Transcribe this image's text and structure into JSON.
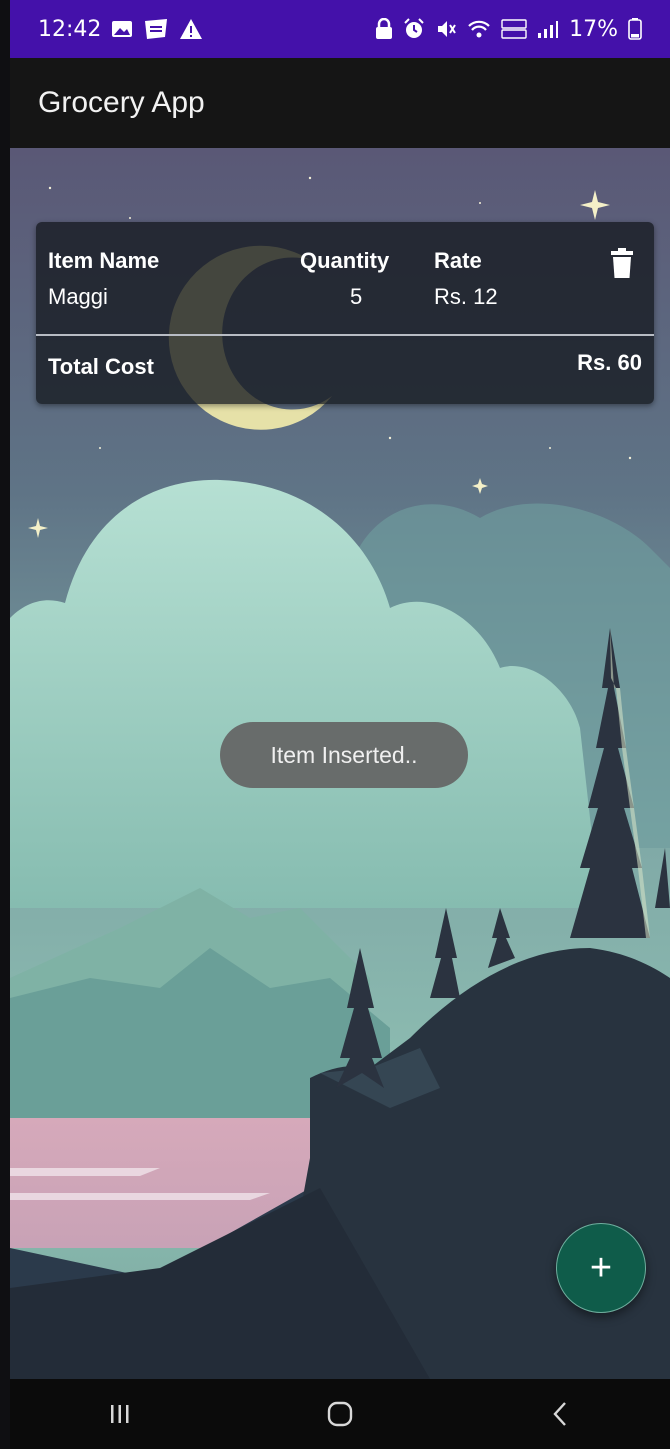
{
  "status_bar": {
    "time": "12:42",
    "battery_text": "17%",
    "icons_left": [
      "gallery-icon",
      "webtoon-icon",
      "warning-icon"
    ],
    "icons_right": [
      "lock-icon",
      "alarm-icon",
      "mute-icon",
      "wifi-icon",
      "volte-icon",
      "signal-icon",
      "battery-icon"
    ]
  },
  "app_bar": {
    "title": "Grocery App"
  },
  "item_card": {
    "headers": {
      "name": "Item Name",
      "quantity": "Quantity",
      "rate": "Rate"
    },
    "items": [
      {
        "name": "Maggi",
        "quantity": "5",
        "rate": "Rs. 12"
      }
    ],
    "total_label": "Total Cost",
    "total_value": "Rs. 60",
    "delete_icon": "trash-icon"
  },
  "toast": {
    "message": "Item Inserted.."
  },
  "fab": {
    "label": "+",
    "icon": "add-icon"
  },
  "nav_bar": {
    "buttons": [
      "recents-icon",
      "home-icon",
      "back-icon"
    ]
  },
  "colors": {
    "status_bar": "#4411aa",
    "app_bar": "#151515",
    "fab": "#0f5c4a",
    "toast": "#646464",
    "card": "#16191f"
  }
}
